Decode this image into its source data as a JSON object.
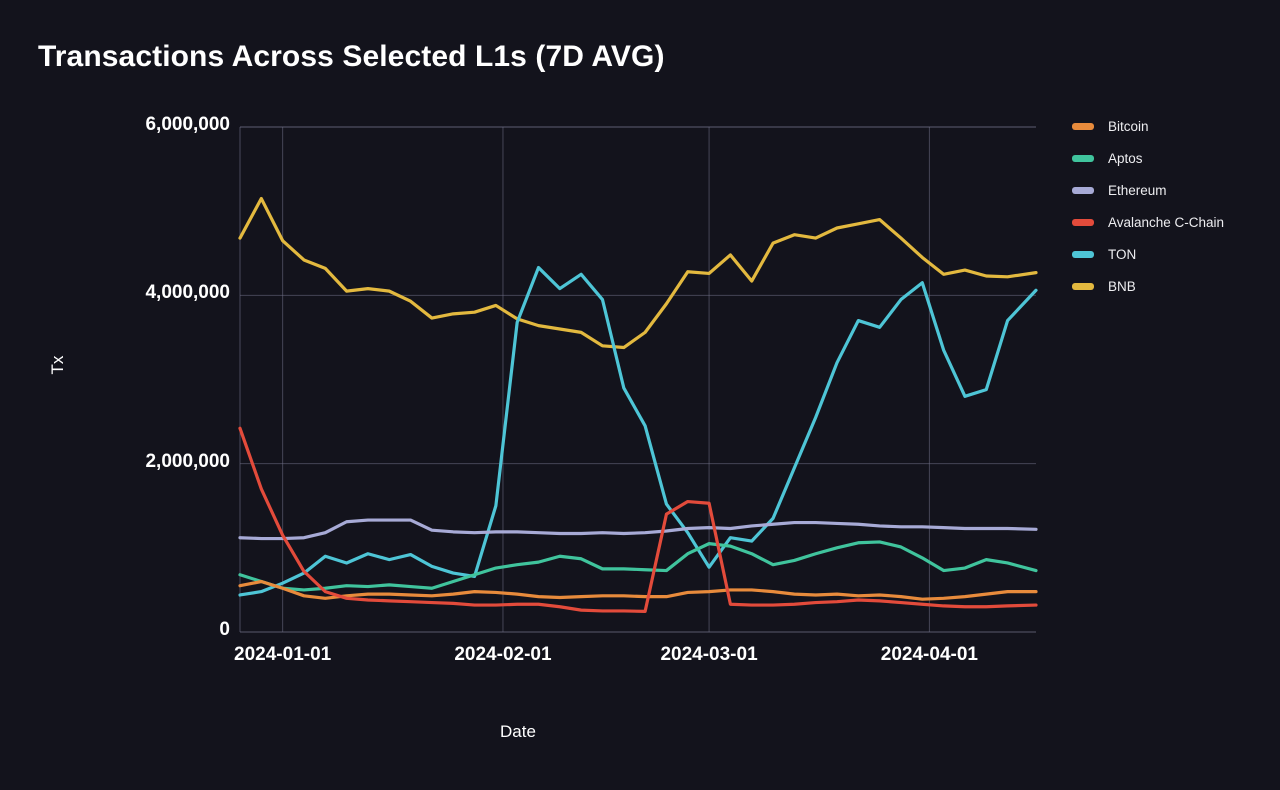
{
  "chart_data": {
    "type": "line",
    "title": "Transactions Across Selected L1s (7D AVG)",
    "xlabel": "Date",
    "ylabel": "Tx",
    "grid": true,
    "legend_position": "right",
    "xlim": [
      "2023-12-26",
      "2024-04-16"
    ],
    "ylim": [
      0,
      6000000
    ],
    "ytick_labels": [
      "0",
      "2,000,000",
      "4,000,000",
      "6,000,000"
    ],
    "ytick_values": [
      0,
      2000000,
      4000000,
      6000000
    ],
    "xtick_labels": [
      "2024-01-01",
      "2024-02-01",
      "2024-03-01",
      "2024-04-01"
    ],
    "xtick_values": [
      "2024-01-01",
      "2024-02-01",
      "2024-03-01",
      "2024-04-01"
    ],
    "x": [
      "2023-12-26",
      "2023-12-29",
      "2024-01-01",
      "2024-01-04",
      "2024-01-07",
      "2024-01-10",
      "2024-01-13",
      "2024-01-16",
      "2024-01-19",
      "2024-01-22",
      "2024-01-25",
      "2024-01-28",
      "2024-01-31",
      "2024-02-03",
      "2024-02-06",
      "2024-02-09",
      "2024-02-12",
      "2024-02-15",
      "2024-02-18",
      "2024-02-21",
      "2024-02-24",
      "2024-02-27",
      "2024-03-01",
      "2024-03-04",
      "2024-03-07",
      "2024-03-10",
      "2024-03-13",
      "2024-03-16",
      "2024-03-19",
      "2024-03-22",
      "2024-03-25",
      "2024-03-28",
      "2024-03-31",
      "2024-04-03",
      "2024-04-06",
      "2024-04-09",
      "2024-04-12",
      "2024-04-16"
    ],
    "series": [
      {
        "name": "BNB",
        "color": "#e3b93f",
        "values": [
          4680000,
          5150000,
          4650000,
          4420000,
          4320000,
          4050000,
          4080000,
          4050000,
          3930000,
          3730000,
          3780000,
          3800000,
          3880000,
          3720000,
          3640000,
          3600000,
          3560000,
          3400000,
          3380000,
          3560000,
          3900000,
          4280000,
          4260000,
          4480000,
          4170000,
          4620000,
          4720000,
          4680000,
          4800000,
          4850000,
          4900000,
          4680000,
          4450000,
          4250000,
          4300000,
          4230000,
          4220000,
          4270000
        ]
      },
      {
        "name": "TON",
        "color": "#4ec5d6",
        "values": [
          440000,
          480000,
          580000,
          700000,
          900000,
          820000,
          930000,
          860000,
          920000,
          780000,
          700000,
          660000,
          1500000,
          3680000,
          4330000,
          4080000,
          4250000,
          3950000,
          2900000,
          2450000,
          1520000,
          1180000,
          770000,
          1120000,
          1080000,
          1350000,
          1950000,
          2550000,
          3200000,
          3700000,
          3620000,
          3950000,
          4150000,
          3350000,
          2800000,
          2880000,
          3700000,
          4060000
        ]
      },
      {
        "name": "Ethereum",
        "color": "#a7aad6",
        "values": [
          1120000,
          1110000,
          1110000,
          1120000,
          1180000,
          1310000,
          1330000,
          1330000,
          1330000,
          1210000,
          1190000,
          1180000,
          1190000,
          1190000,
          1180000,
          1170000,
          1170000,
          1180000,
          1170000,
          1180000,
          1200000,
          1230000,
          1240000,
          1230000,
          1260000,
          1280000,
          1300000,
          1300000,
          1290000,
          1280000,
          1260000,
          1250000,
          1250000,
          1240000,
          1230000,
          1230000,
          1230000,
          1220000
        ]
      },
      {
        "name": "Aptos",
        "color": "#40c49d",
        "values": [
          680000,
          600000,
          520000,
          500000,
          520000,
          550000,
          540000,
          560000,
          540000,
          520000,
          600000,
          680000,
          760000,
          800000,
          830000,
          900000,
          870000,
          750000,
          750000,
          740000,
          730000,
          930000,
          1050000,
          1020000,
          930000,
          800000,
          850000,
          930000,
          1000000,
          1060000,
          1070000,
          1010000,
          880000,
          730000,
          760000,
          860000,
          820000,
          730000
        ]
      },
      {
        "name": "Bitcoin",
        "color": "#e88b3c",
        "values": [
          550000,
          600000,
          520000,
          430000,
          400000,
          430000,
          450000,
          450000,
          440000,
          430000,
          450000,
          480000,
          470000,
          450000,
          420000,
          410000,
          420000,
          430000,
          430000,
          420000,
          420000,
          470000,
          480000,
          500000,
          500000,
          480000,
          450000,
          440000,
          450000,
          430000,
          440000,
          420000,
          390000,
          400000,
          420000,
          450000,
          480000,
          480000
        ]
      },
      {
        "name": "Avalanche C-Chain",
        "color": "#e34b3b",
        "values": [
          2420000,
          1700000,
          1150000,
          720000,
          480000,
          400000,
          380000,
          370000,
          360000,
          350000,
          340000,
          320000,
          320000,
          330000,
          330000,
          300000,
          260000,
          250000,
          250000,
          245000,
          1400000,
          1550000,
          1530000,
          330000,
          320000,
          320000,
          330000,
          350000,
          360000,
          380000,
          370000,
          350000,
          330000,
          310000,
          300000,
          300000,
          310000,
          320000
        ]
      }
    ]
  },
  "legend": {
    "items": [
      {
        "label": "Bitcoin",
        "color": "#e88b3c"
      },
      {
        "label": "Aptos",
        "color": "#40c49d"
      },
      {
        "label": "Ethereum",
        "color": "#a7aad6"
      },
      {
        "label": "Avalanche C-Chain",
        "color": "#e34b3b"
      },
      {
        "label": "TON",
        "color": "#4ec5d6"
      },
      {
        "label": "BNB",
        "color": "#e3b93f"
      }
    ]
  },
  "theme": {
    "background": "#13131c",
    "plot_background": "#13131c",
    "grid_color": "#6f6f86",
    "text_color": "#ffffff"
  }
}
